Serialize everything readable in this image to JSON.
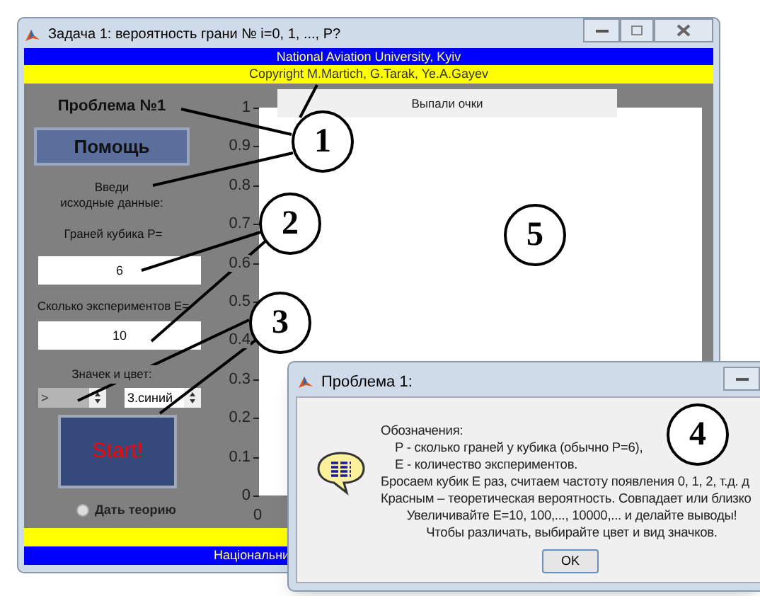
{
  "main_window": {
    "title": "Задача 1: вероятность грани № i=0, 1, ..., P?",
    "header_lines": [
      "National Aviation University, Kyiv",
      "Copyright M.Martich, G.Tarak, Ye.A.Gayev"
    ],
    "problem_title": "Проблема №1",
    "help_button": "Помощь",
    "prompt_lines": [
      "Введи",
      "исходные данные:"
    ],
    "fields": [
      {
        "label": "Граней кубика P=",
        "value": "6"
      },
      {
        "label": "Сколько экспериментов E=",
        "value": "10"
      }
    ],
    "marker_label": "Значек и цвет:",
    "spinners": [
      {
        "value": ">",
        "disabled": true
      },
      {
        "value": "3.синий",
        "disabled": false
      }
    ],
    "start_button": "Start!",
    "theory_radio": {
      "label": "Дать теорию",
      "selected": false
    },
    "axes": {
      "title": "Выпали очки",
      "y_tick_labels": [
        "1",
        "0.9",
        "0.8",
        "0.7",
        "0.6",
        "0.5",
        "0.4",
        "0.3",
        "0.2",
        "0.1",
        "0"
      ],
      "x_tick_labels": [
        "0"
      ]
    },
    "footer_text": "Національни"
  },
  "dialog": {
    "title": "Проблема 1:",
    "lines": [
      {
        "kind": "left",
        "text": "Обозначения:"
      },
      {
        "kind": "indent",
        "text": "P - сколько граней у кубика (обычно P=6),"
      },
      {
        "kind": "indent",
        "text": "E - количество экспериментов."
      },
      {
        "kind": "left",
        "text": "Бросаем кубик E раз, считаем частоту появления 0, 1, 2, т.д. д"
      },
      {
        "kind": "left",
        "text": "Красным – теоретическая вероятность. Совпадает или близко"
      },
      {
        "kind": "center",
        "text": "Увеличивайте E=10, 100,..., 10000,... и делайте выводы!"
      },
      {
        "kind": "center",
        "text": "Чтобы различать, выбирайте цвет и вид значков."
      }
    ],
    "ok_button": "OK"
  },
  "callouts": [
    "1",
    "2",
    "3",
    "4",
    "5"
  ]
}
